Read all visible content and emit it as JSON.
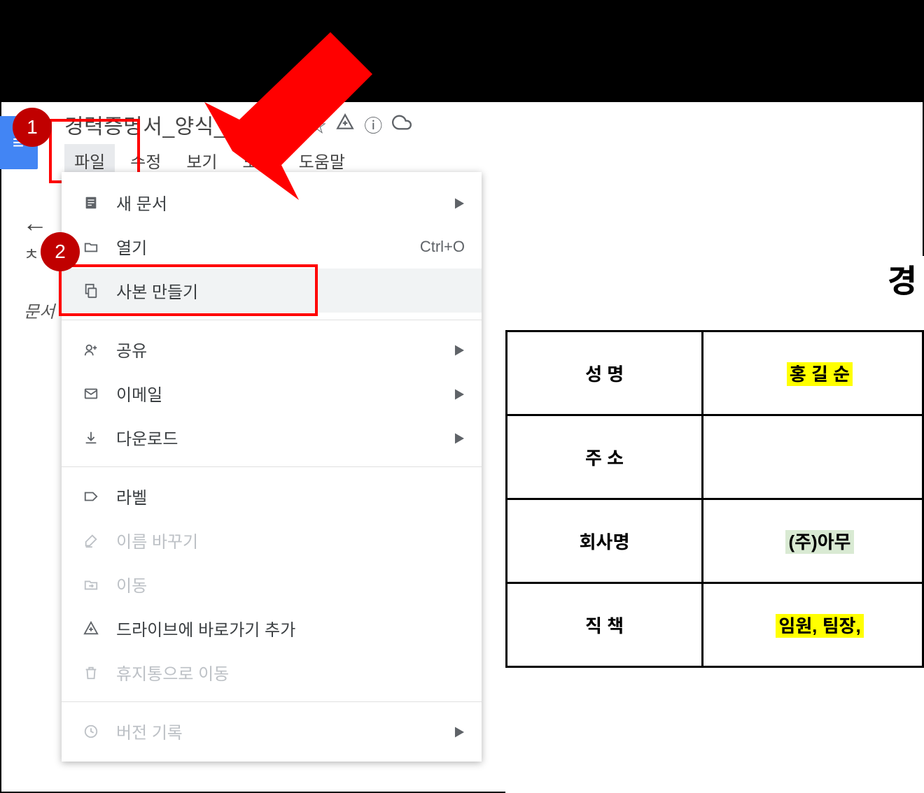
{
  "document": {
    "title": "경력증명서_양식_230330"
  },
  "menu_bar": {
    "file": "파일",
    "edit": "수정",
    "view": "보기",
    "tools": "도구",
    "help": "도움말"
  },
  "file_menu": {
    "new_doc": "새 문서",
    "open": "열기",
    "open_shortcut": "Ctrl+O",
    "make_copy": "사본 만들기",
    "share": "공유",
    "email": "이메일",
    "download": "다운로드",
    "label": "라벨",
    "rename": "이름 바꾸기",
    "move": "이동",
    "add_shortcut": "드라이브에 바로가기 추가",
    "move_to_trash": "휴지통으로 이동",
    "version_history": "버전 기록"
  },
  "sidebar": {
    "text1": "ㅊ",
    "text2": "문서"
  },
  "preview": {
    "heading": "경",
    "rows": [
      {
        "label": "성  명",
        "value": "홍 길 순",
        "highlight": "yellow"
      },
      {
        "label": "주  소",
        "value": "",
        "highlight": ""
      },
      {
        "label": "회사명",
        "value": "(주)아무",
        "highlight": "green"
      },
      {
        "label": "직  책",
        "value": "임원, 팀장,",
        "highlight": "yellow"
      }
    ]
  },
  "annotations": {
    "n1": "1",
    "n2": "2"
  }
}
